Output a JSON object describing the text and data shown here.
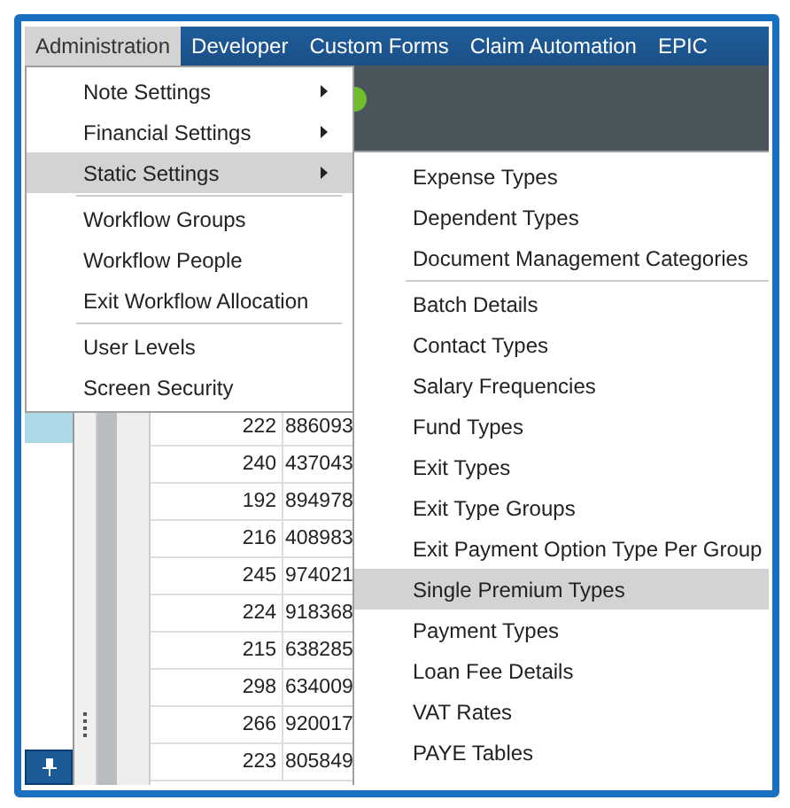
{
  "menu_bar": [
    {
      "label": "Administration",
      "selected": true
    },
    {
      "label": "Developer",
      "selected": false
    },
    {
      "label": "Custom Forms",
      "selected": false
    },
    {
      "label": "Claim Automation",
      "selected": false
    },
    {
      "label": "EPIC",
      "selected": false
    }
  ],
  "left_list": {
    "rows": [
      {
        "selected": true
      }
    ]
  },
  "grid": {
    "rows": [
      {
        "column_1": "222",
        "column_2": "886093"
      },
      {
        "column_1": "240",
        "column_2": "437043"
      },
      {
        "column_1": "192",
        "column_2": "894978"
      },
      {
        "column_1": "216",
        "column_2": "408983"
      },
      {
        "column_1": "245",
        "column_2": "974021"
      },
      {
        "column_1": "224",
        "column_2": "918368"
      },
      {
        "column_1": "215",
        "column_2": "638285"
      },
      {
        "column_1": "298",
        "column_2": "634009"
      },
      {
        "column_1": "266",
        "column_2": "920017"
      },
      {
        "column_1": "223",
        "column_2": "805849"
      }
    ]
  },
  "administration_menu": {
    "items": [
      {
        "kind": "item",
        "label": "Note Settings",
        "has_submenu": true,
        "selected": false
      },
      {
        "kind": "item",
        "label": "Financial Settings",
        "has_submenu": true,
        "selected": false
      },
      {
        "kind": "item",
        "label": "Static Settings",
        "has_submenu": true,
        "selected": true
      },
      {
        "kind": "separator"
      },
      {
        "kind": "item",
        "label": "Workflow Groups",
        "has_submenu": false,
        "selected": false
      },
      {
        "kind": "item",
        "label": "Workflow People",
        "has_submenu": false,
        "selected": false
      },
      {
        "kind": "item",
        "label": "Exit Workflow Allocation",
        "has_submenu": false,
        "selected": false
      },
      {
        "kind": "separator"
      },
      {
        "kind": "item",
        "label": "User Levels",
        "has_submenu": false,
        "selected": false
      },
      {
        "kind": "item",
        "label": "Screen Security",
        "has_submenu": false,
        "selected": false
      }
    ]
  },
  "static_settings_menu": {
    "items": [
      {
        "kind": "item",
        "label": "Expense Types",
        "selected": false
      },
      {
        "kind": "item",
        "label": "Dependent Types",
        "selected": false
      },
      {
        "kind": "item",
        "label": "Document Management Categories",
        "selected": false
      },
      {
        "kind": "separator"
      },
      {
        "kind": "item",
        "label": "Batch Details",
        "selected": false
      },
      {
        "kind": "item",
        "label": "Contact Types",
        "selected": false
      },
      {
        "kind": "item",
        "label": "Salary Frequencies",
        "selected": false
      },
      {
        "kind": "item",
        "label": "Fund Types",
        "selected": false
      },
      {
        "kind": "item",
        "label": "Exit Types",
        "selected": false
      },
      {
        "kind": "item",
        "label": "Exit Type Groups",
        "selected": false
      },
      {
        "kind": "item",
        "label": "Exit Payment Option Type Per Group",
        "selected": false
      },
      {
        "kind": "item",
        "label": "Single Premium Types",
        "selected": true
      },
      {
        "kind": "item",
        "label": "Payment Types",
        "selected": false
      },
      {
        "kind": "item",
        "label": "Loan Fee Details",
        "selected": false
      },
      {
        "kind": "item",
        "label": "VAT Rates",
        "selected": false
      },
      {
        "kind": "item",
        "label": "PAYE Tables",
        "selected": false
      }
    ]
  }
}
